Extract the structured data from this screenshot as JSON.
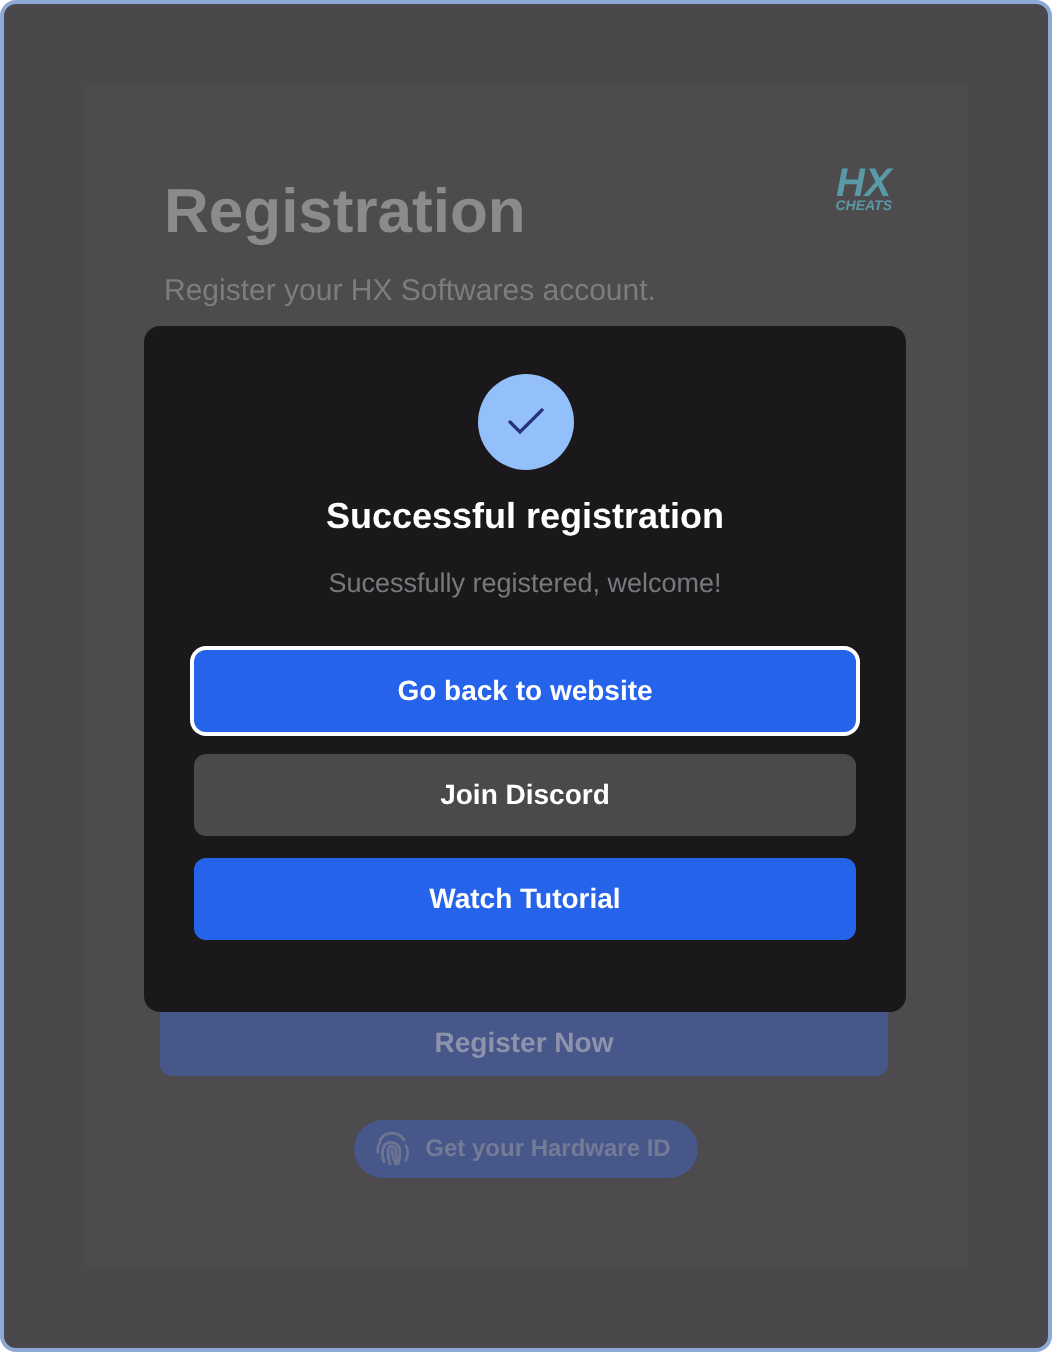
{
  "background": {
    "title": "Registration",
    "subtitle": "Register your HX Softwares account.",
    "logo": {
      "top": "HX",
      "bottom": "CHEATS"
    },
    "register_button": "Register Now",
    "hardware_button": "Get your Hardware ID"
  },
  "dialog": {
    "title": "Successful registration",
    "message": "Sucessfully registered, welcome!",
    "buttons": [
      {
        "label": "Go back to website",
        "kind": "primary",
        "focused": true
      },
      {
        "label": "Join Discord",
        "kind": "secondary",
        "focused": false
      },
      {
        "label": "Watch Tutorial",
        "kind": "primary",
        "focused": false
      }
    ]
  }
}
